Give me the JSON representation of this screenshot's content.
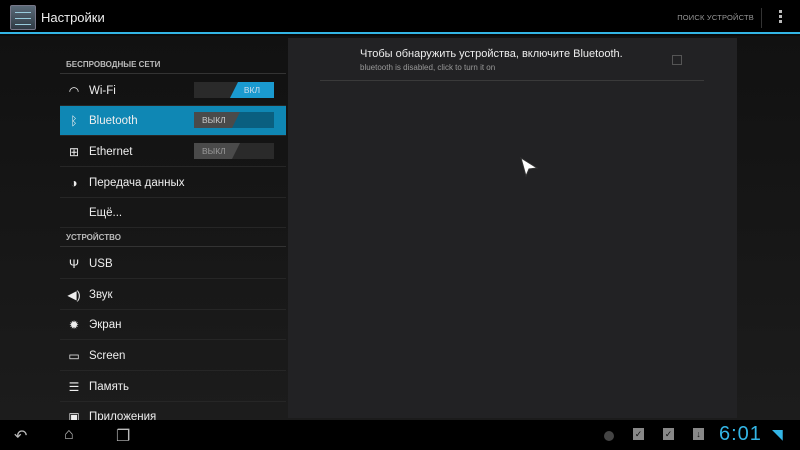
{
  "action_bar": {
    "title": "Настройки",
    "search_label": "ПОИСК УСТРОЙСТВ"
  },
  "sidebar": {
    "section_wireless": "БЕСПРОВОДНЫЕ СЕТИ",
    "section_device": "УСТРОЙСТВО",
    "items": [
      {
        "label": "Wi-Fi",
        "icon": "wifi-icon",
        "switch": "ВКЛ",
        "on": true
      },
      {
        "label": "Bluetooth",
        "icon": "bluetooth-icon",
        "switch": "ВЫКЛ",
        "on": false,
        "selected": true
      },
      {
        "label": "Ethernet",
        "icon": "ethernet-icon",
        "switch": "ВЫКЛ",
        "on": false
      },
      {
        "label": "Передача данных",
        "icon": "data-usage-icon"
      },
      {
        "label": "Ещё..."
      },
      {
        "label": "USB",
        "icon": "usb-icon"
      },
      {
        "label": "Звук",
        "icon": "sound-icon"
      },
      {
        "label": "Экран",
        "icon": "display-icon"
      },
      {
        "label": "Screen",
        "icon": "screen-icon"
      },
      {
        "label": "Память",
        "icon": "storage-icon"
      },
      {
        "label": "Приложения",
        "icon": "apps-icon"
      }
    ]
  },
  "panel": {
    "title": "Чтобы обнаружить устройства, включите Bluetooth.",
    "subtitle": "bluetooth is disabled, click to turn it on",
    "checked": false
  },
  "status": {
    "time": "6:01"
  },
  "colors": {
    "accent": "#33b5e5",
    "selected": "#0f87b4"
  }
}
